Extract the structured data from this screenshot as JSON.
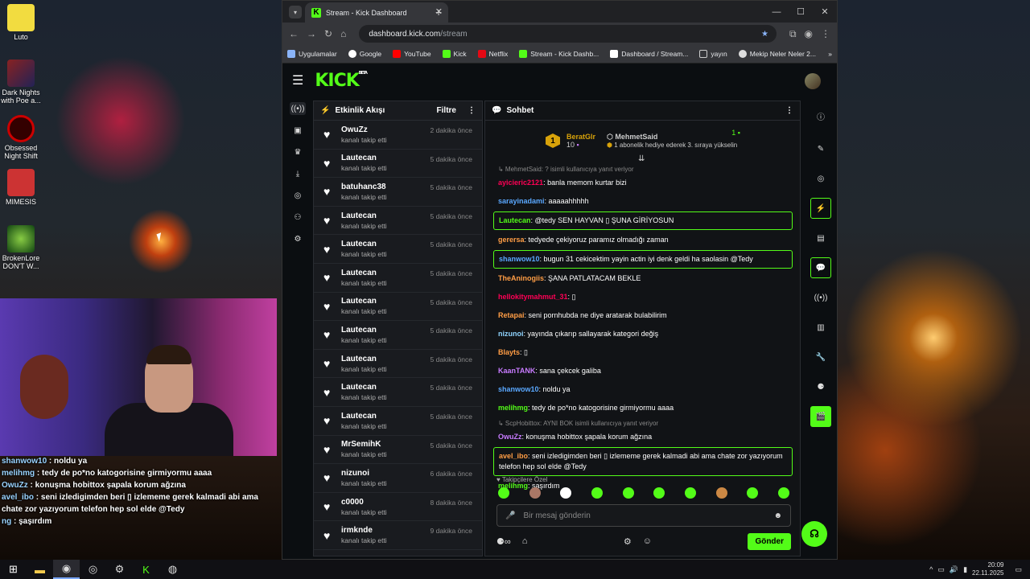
{
  "desktop": {
    "icons": [
      {
        "label": "Luto"
      },
      {
        "label": "Dark Nights with Poe a..."
      },
      {
        "label": "Obsessed Night Shift"
      },
      {
        "label": "MIMESIS"
      },
      {
        "label": "BrokenLore DON'T W..."
      }
    ]
  },
  "overlay_chat": [
    {
      "user": "shanwow10",
      "text": " : noldu ya"
    },
    {
      "user": "melihmg",
      "text": " : tedy de po*no katogorisine girmiyormu aaaa"
    },
    {
      "user": "OwuZz",
      "text": " : konuşma hobittox şapala korum ağzına"
    },
    {
      "user": "avel_ibo",
      "text": " : seni izledigimden beri ▯ izlememe gerek kalmadi abi ama chate zor yazıyorum telefon hep sol elde @Tedy"
    },
    {
      "user": "ng",
      "text": " : şaşırdım"
    }
  ],
  "browser": {
    "tab_title": "Stream - Kick Dashboard",
    "url_host": "dashboard.kick.com",
    "url_path": "/stream",
    "bookmarks": [
      "Uygulamalar",
      "Google",
      "YouTube",
      "Kick",
      "Netflix",
      "Stream - Kick Dashb...",
      "Dashboard / Stream...",
      "yayın",
      "Mekip Neler Neler 2..."
    ]
  },
  "kick": {
    "logo": "KICK",
    "logo_beta": "BETA",
    "activity_feed": {
      "title": "Etkinlik Akışı",
      "filter": "Filtre",
      "items": [
        {
          "name": "OwuZz",
          "action": "kanalı takip etti",
          "time": "2 dakika önce"
        },
        {
          "name": "Lautecan",
          "action": "kanalı takip etti",
          "time": "5 dakika önce"
        },
        {
          "name": "batuhanc38",
          "action": "kanalı takip etti",
          "time": "5 dakika önce"
        },
        {
          "name": "Lautecan",
          "action": "kanalı takip etti",
          "time": "5 dakika önce"
        },
        {
          "name": "Lautecan",
          "action": "kanalı takip etti",
          "time": "5 dakika önce"
        },
        {
          "name": "Lautecan",
          "action": "kanalı takip etti",
          "time": "5 dakika önce"
        },
        {
          "name": "Lautecan",
          "action": "kanalı takip etti",
          "time": "5 dakika önce"
        },
        {
          "name": "Lautecan",
          "action": "kanalı takip etti",
          "time": "5 dakika önce"
        },
        {
          "name": "Lautecan",
          "action": "kanalı takip etti",
          "time": "5 dakika önce"
        },
        {
          "name": "Lautecan",
          "action": "kanalı takip etti",
          "time": "5 dakika önce"
        },
        {
          "name": "Lautecan",
          "action": "kanalı takip etti",
          "time": "5 dakika önce"
        },
        {
          "name": "MrSemihK",
          "action": "kanalı takip etti",
          "time": "5 dakika önce"
        },
        {
          "name": "nizunoi",
          "action": "kanalı takip etti",
          "time": "6 dakika önce"
        },
        {
          "name": "c0000",
          "action": "kanalı takip etti",
          "time": "8 dakika önce"
        },
        {
          "name": "irmknde",
          "action": "kanalı takip etti",
          "time": "9 dakika önce"
        }
      ]
    },
    "chat": {
      "title": "Sohbet",
      "pinned": {
        "rank": "1",
        "user1": "BeratGlr",
        "user1_count": "10",
        "user2": "MehmetSaid",
        "user2_count": "1",
        "user2_text": "1 abonelik hediye ederek 3. sıraya yükselin"
      },
      "top_partial": "ScpHobitto: AYNI BOK",
      "reply1": "↳ MehmetSaid: ? isimli kullanıcıya yanıt veriyor",
      "messages": [
        {
          "user": "ayicieric2121",
          "text": ": banla memom kurtar bizi",
          "cls": "u6",
          "hl": false
        },
        {
          "user": "sarayinadami",
          "text": ": aaaaahhhhh",
          "cls": "u3",
          "hl": false
        },
        {
          "user": "Lautecan",
          "text": ": @tedy SEN HAYVAN ▯ ŞUNA GİRİYOSUN",
          "cls": "u2",
          "hl": true
        },
        {
          "user": "gerersa",
          "text": ": tedyede çekiyoruz paramız olmadığı zaman",
          "cls": "u4",
          "hl": false
        },
        {
          "user": "shanwow10",
          "text": ": bugun 31 cekicektim yayin actin iyi denk geldi ha saolasin @Tedy",
          "cls": "u3",
          "hl": true
        },
        {
          "user": "TheAninogiis",
          "text": ": ŞANA PATLATACAM BEKLE",
          "cls": "u4",
          "hl": false
        },
        {
          "user": "hellokitymahmut_31",
          "text": ": ▯",
          "cls": "u6",
          "hl": false
        },
        {
          "user": "Retapai",
          "text": ": seni pornhubda ne diye aratarak bulabilirim",
          "cls": "u4",
          "hl": false
        },
        {
          "user": "nizunoi",
          "text": ": yayında çıkarıp sallayarak kategori değiş",
          "cls": "u7",
          "hl": false
        },
        {
          "user": "Blayts",
          "text": ": ▯",
          "cls": "u4",
          "hl": false
        },
        {
          "user": "KaanTANK",
          "text": ": sana çekcek galiba",
          "cls": "u5",
          "hl": false
        },
        {
          "user": "shanwow10",
          "text": ": noldu ya",
          "cls": "u3",
          "hl": false
        },
        {
          "user": "melihmg",
          "text": ": tedy de po*no katogorisine girmiyormu aaaa",
          "cls": "u2",
          "hl": false
        }
      ],
      "reply2": "↳ ScpHobittox: AYNI BOK isimli kullanıcıya yanıt veriyor",
      "messages2": [
        {
          "user": "OwuZz",
          "text": ": konuşma hobittox şapala korum ağzına",
          "cls": "u5",
          "hl": false
        },
        {
          "user": "avel_ibo",
          "text": ": seni izledigimden beri ▯ izlememe gerek kalmadi abi ama chate zor yazıyorum telefon hep sol elde @Tedy",
          "cls": "u4",
          "hl": true
        },
        {
          "user": "melihmg",
          "text": ": şaşırdım",
          "cls": "u2",
          "hl": false
        }
      ],
      "followers_only": "♥ Takipçilere Özel",
      "input_placeholder": "Bir mesaj gönderin",
      "send_label": "Gönder"
    }
  },
  "taskbar": {
    "time": "20:09",
    "date": "22.11.2025"
  },
  "colors": {
    "kick_green": "#53fc18"
  }
}
